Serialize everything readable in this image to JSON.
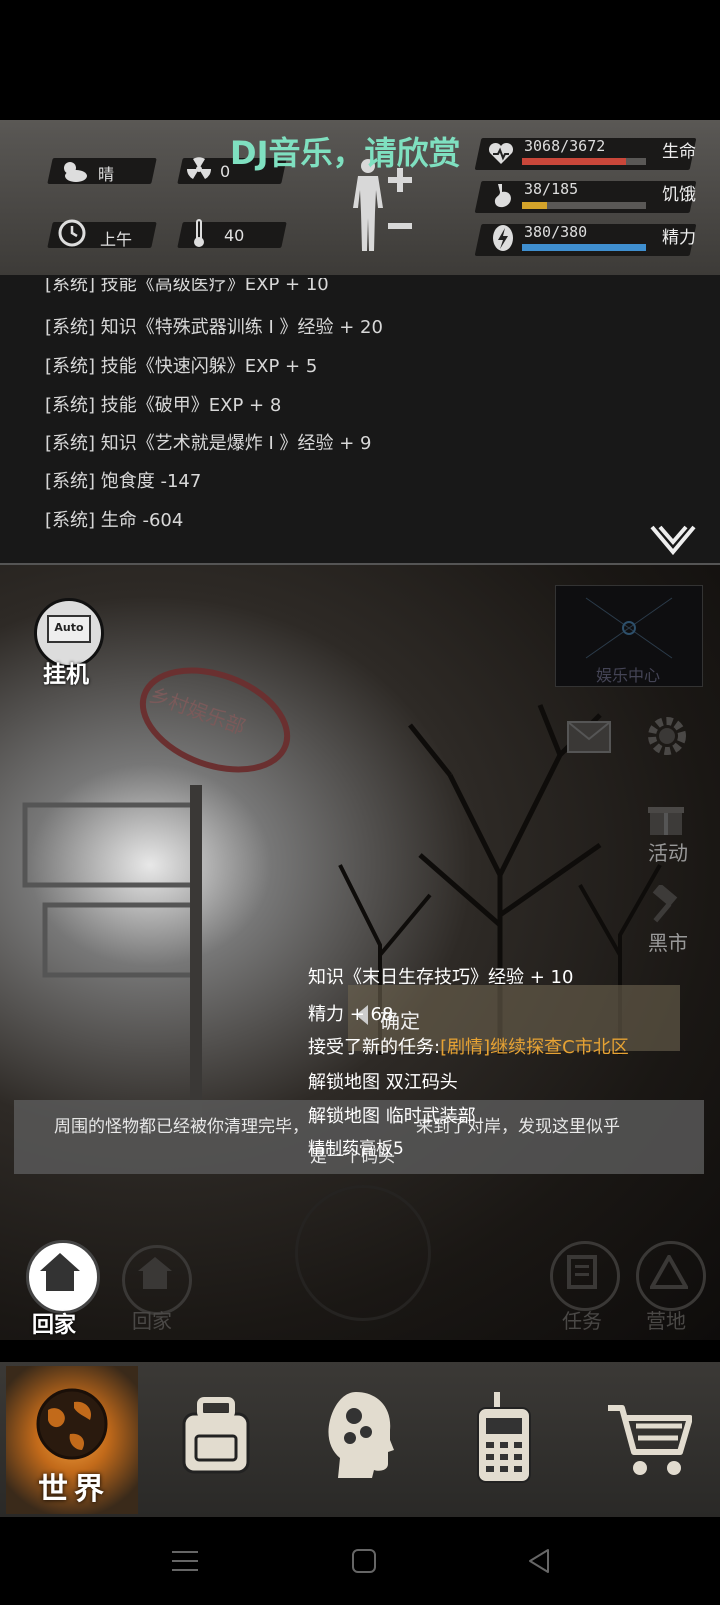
{
  "overlay_title": "DJ音乐，请欣赏",
  "status": {
    "weather": "晴",
    "radiation": "0",
    "time_of_day": "上午",
    "temperature": "40",
    "health": {
      "text": "3068/3672",
      "label": "生命",
      "fraction": 0.835,
      "color": "#c9473a"
    },
    "hunger": {
      "text": "38/185",
      "label": "饥饿",
      "fraction": 0.205,
      "color": "#d4a32a"
    },
    "energy": {
      "text": "380/380",
      "label": "精力",
      "fraction": 1.0,
      "color": "#3f8fd0"
    }
  },
  "log": [
    "[系统] 技能《高级医疗》EXP + 10",
    "[系统] 知识《特殊武器训练 I 》经验 + 20",
    "[系统] 技能《快速闪躲》EXP + 5",
    "[系统] 技能《破甲》EXP + 8",
    "[系统] 知识《艺术就是爆炸 I 》经验 + 9",
    "[系统] 饱食度 -147",
    "[系统] 生命 -604"
  ],
  "scene": {
    "auto_label": "挂机",
    "auto_icon_text": "Auto",
    "sign_text": "乡村娱乐部",
    "entertainment_label": "娱乐中心",
    "activity_label": "活动",
    "black_market_label": "黑市",
    "home_label": "回家",
    "home_label_faded": "回家",
    "task_label": "任务",
    "camp_label": "营地",
    "confirm_label": "确定"
  },
  "rewards": [
    {
      "text": "知识《末日生存技巧》经验 + 10"
    },
    {
      "text": "精力 + 68"
    },
    {
      "text": "接受了新的任务:",
      "highlight": "[剧情]继续探查C市北区"
    },
    {
      "text": "解锁地图 双江码头"
    },
    {
      "text": "解锁地图 临时武装部"
    },
    {
      "text": "精制药膏"
    }
  ],
  "notice": {
    "line1_a": "周围的怪物都已经被你清理完毕，",
    "line1_b": "来到了对岸，发现这里似乎",
    "overlap": "精制药膏板5",
    "line2": "是一个码头"
  },
  "tabs": {
    "world": "世界"
  },
  "colors": {
    "accent": "#e08a2c",
    "highlight": "#e6a233",
    "mint": "#7fe0c0"
  }
}
